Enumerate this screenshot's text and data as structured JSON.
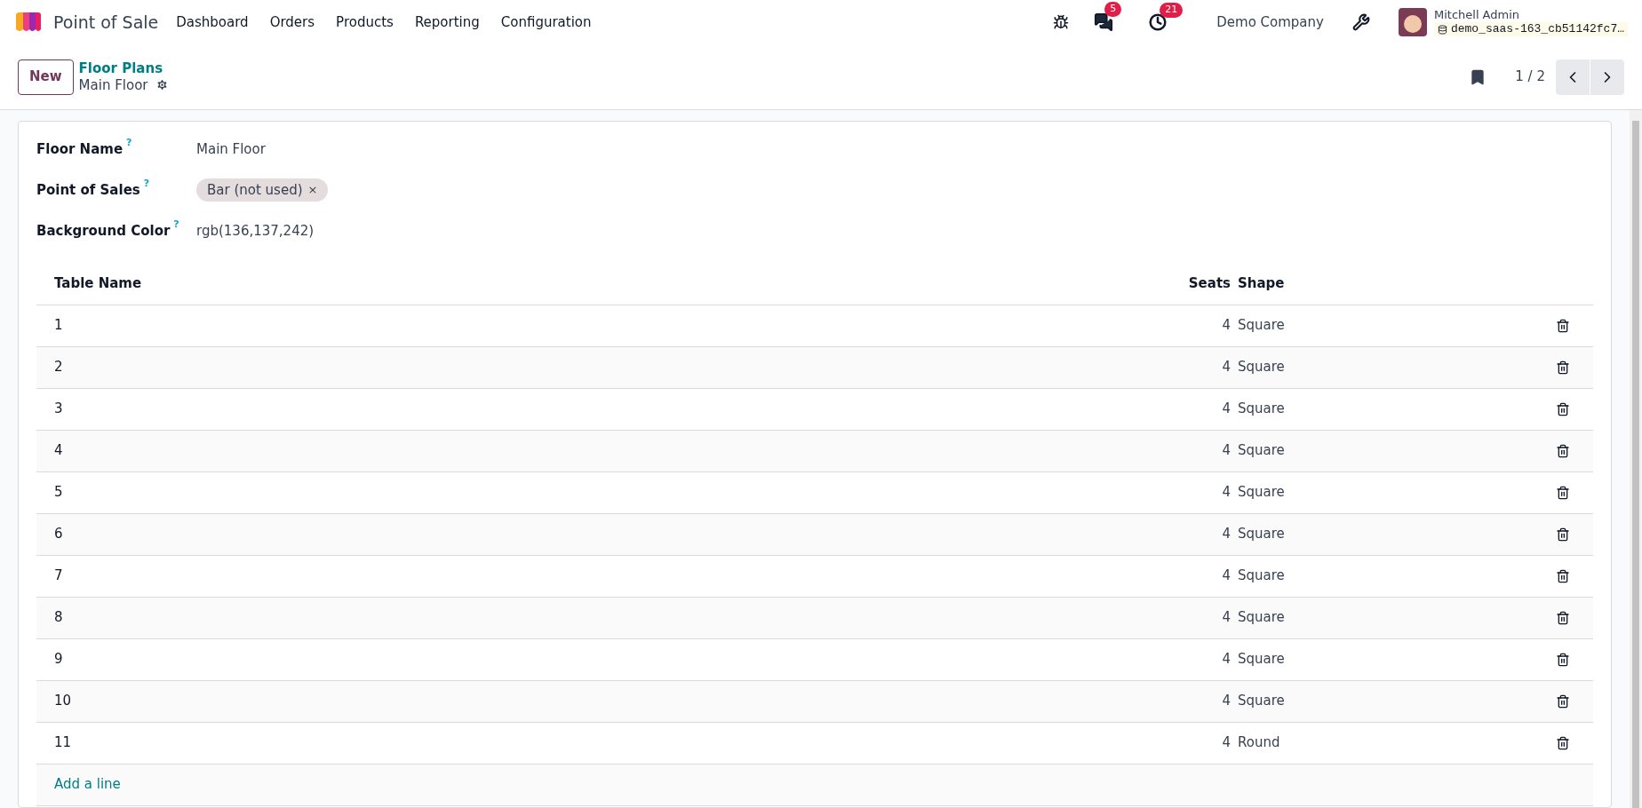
{
  "app": {
    "name": "Point of Sale"
  },
  "menu": [
    "Dashboard",
    "Orders",
    "Products",
    "Reporting",
    "Configuration"
  ],
  "systray": {
    "messages_count": "5",
    "activities_count": "21",
    "company": "Demo Company",
    "user_name": "Mitchell Admin",
    "database": "demo_saas-163_cb51142fc7…"
  },
  "breadcrumb": {
    "parent": "Floor Plans",
    "current": "Main Floor"
  },
  "new_button": "New",
  "pager": "1 / 2",
  "form": {
    "fields": [
      {
        "label": "Floor Name",
        "help": "?",
        "kind": "text",
        "value": "Main Floor"
      },
      {
        "label": "Point of Sales",
        "help": "?",
        "kind": "tags",
        "tags": [
          {
            "label": "Bar (not used)",
            "remove": "×"
          }
        ]
      },
      {
        "label": "Background Color",
        "help": "?",
        "kind": "text",
        "value": "rgb(136,137,242)"
      }
    ]
  },
  "table": {
    "columns": [
      "Table Name",
      "Seats",
      "Shape"
    ],
    "rows": [
      {
        "name": "1",
        "seats": "4",
        "shape": "Square"
      },
      {
        "name": "2",
        "seats": "4",
        "shape": "Square"
      },
      {
        "name": "3",
        "seats": "4",
        "shape": "Square"
      },
      {
        "name": "4",
        "seats": "4",
        "shape": "Square"
      },
      {
        "name": "5",
        "seats": "4",
        "shape": "Square"
      },
      {
        "name": "6",
        "seats": "4",
        "shape": "Square"
      },
      {
        "name": "7",
        "seats": "4",
        "shape": "Square"
      },
      {
        "name": "8",
        "seats": "4",
        "shape": "Square"
      },
      {
        "name": "9",
        "seats": "4",
        "shape": "Square"
      },
      {
        "name": "10",
        "seats": "4",
        "shape": "Square"
      },
      {
        "name": "11",
        "seats": "4",
        "shape": "Round"
      }
    ],
    "add_line": "Add a line"
  }
}
